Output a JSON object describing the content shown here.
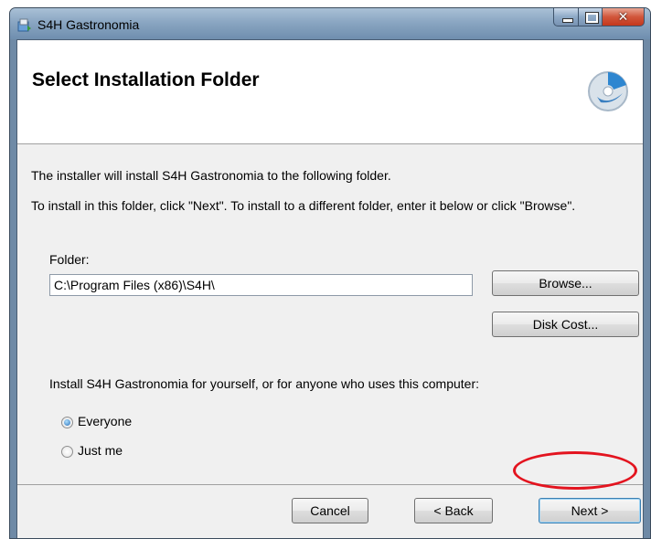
{
  "window": {
    "title": "S4H Gastronomia"
  },
  "header": {
    "title": "Select Installation Folder"
  },
  "body": {
    "intro": "The installer will install S4H Gastronomia to the following folder.",
    "instruction": "To install in this folder, click \"Next\". To install to a different folder, enter it below or click \"Browse\".",
    "folder_label": "Folder:",
    "folder_value": "C:\\Program Files (x86)\\S4H\\",
    "browse_label": "Browse...",
    "disk_cost_label": "Disk Cost...",
    "install_for_text": "Install S4H Gastronomia for yourself, or for anyone who uses this computer:",
    "options": [
      {
        "label": "Everyone",
        "selected": true
      },
      {
        "label": "Just me",
        "selected": false
      }
    ]
  },
  "footer": {
    "cancel_label": "Cancel",
    "back_label": "< Back",
    "next_label": "Next >"
  },
  "icons": {
    "app": "installer-icon",
    "logo": "setup-disc-icon"
  },
  "colors": {
    "highlight": "#e3141f",
    "titlebar": "#8aa6c2"
  }
}
